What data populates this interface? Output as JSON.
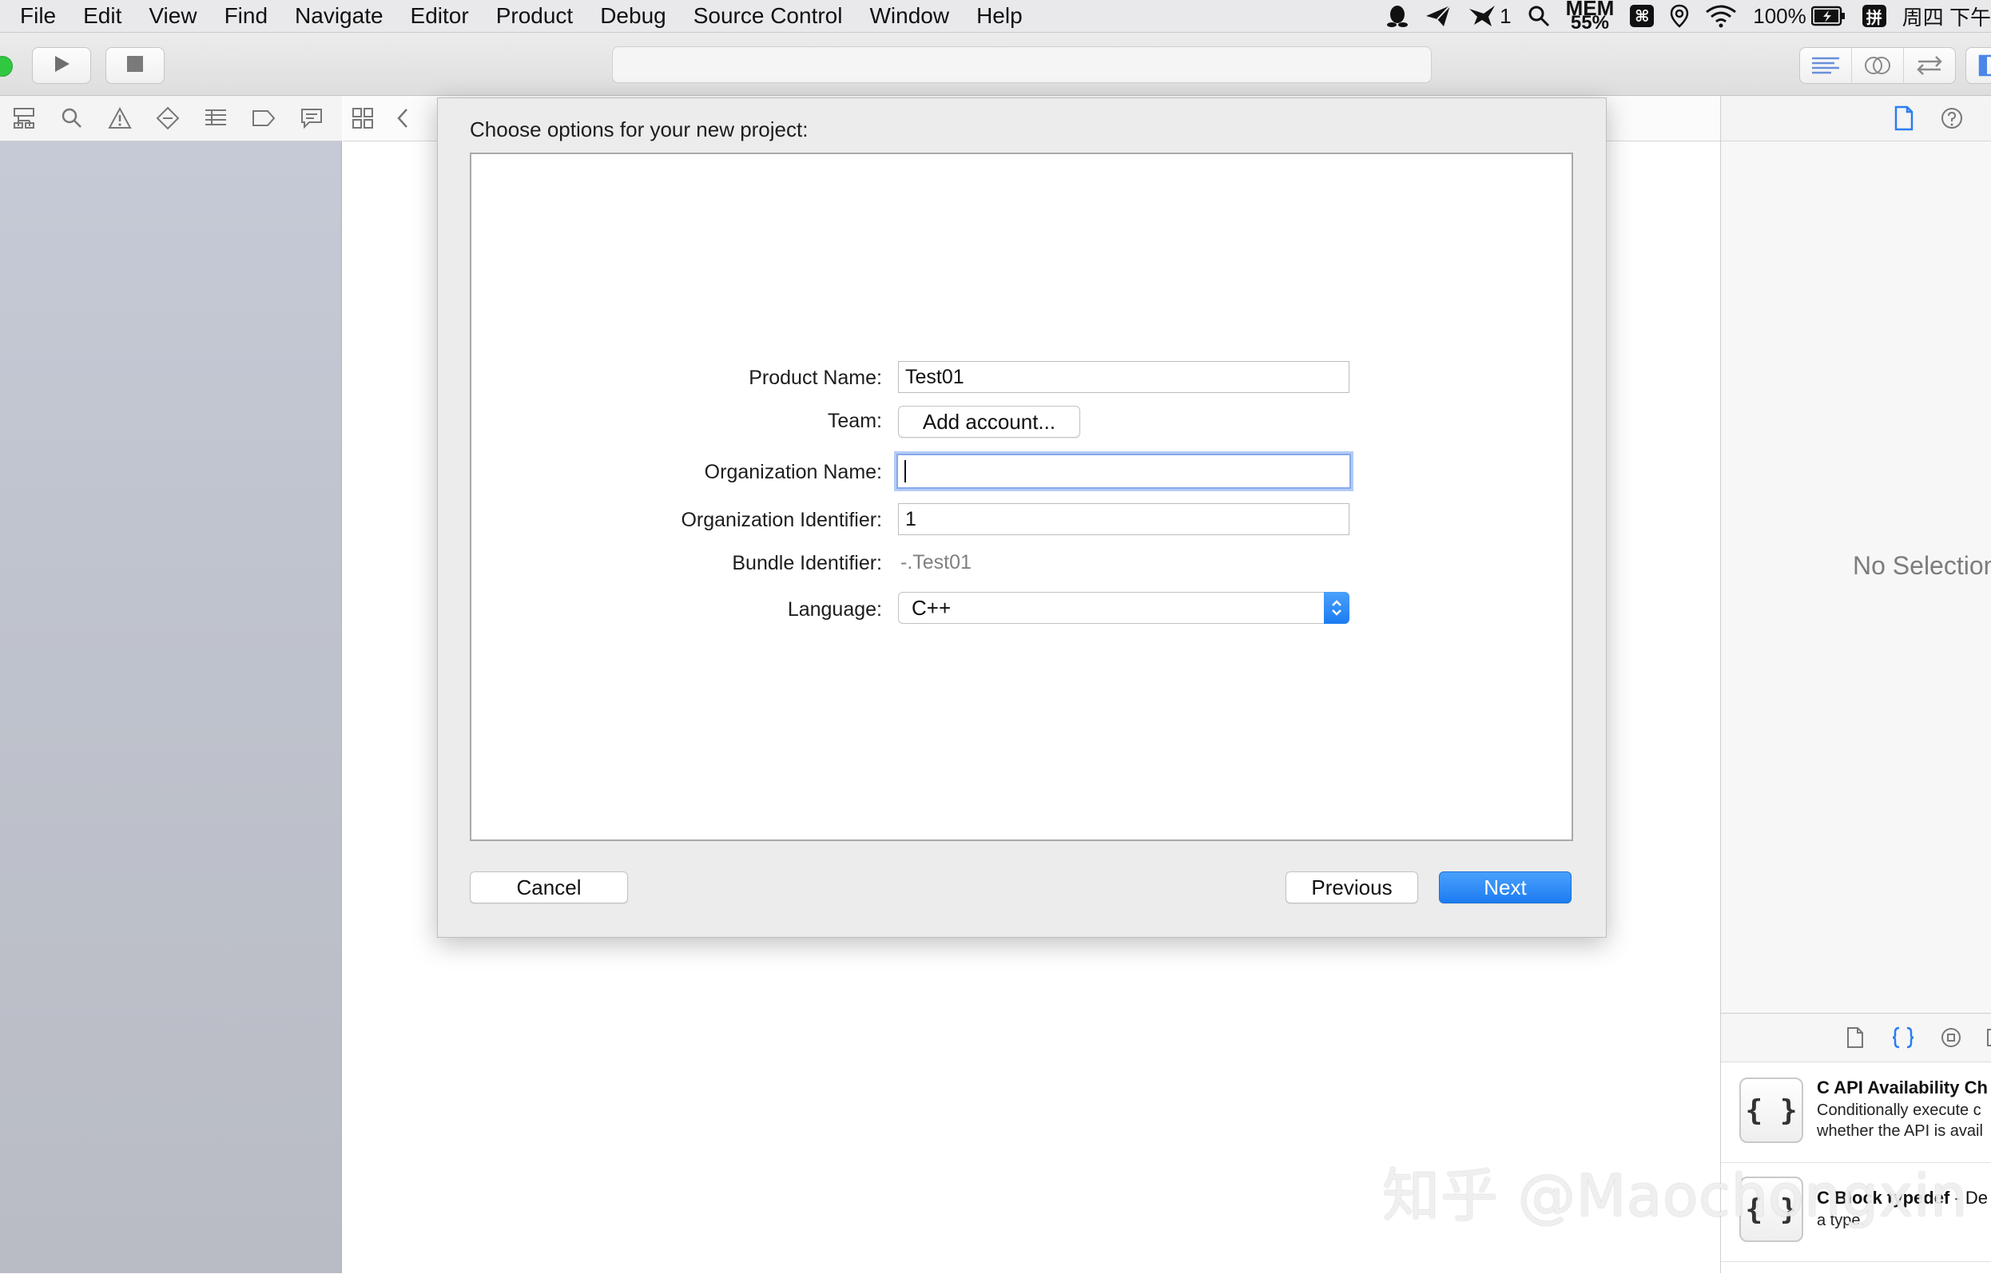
{
  "menubar": {
    "items": [
      "File",
      "Edit",
      "View",
      "Find",
      "Navigate",
      "Editor",
      "Product",
      "Debug",
      "Source Control",
      "Window",
      "Help"
    ],
    "status": {
      "notification_badge": "1",
      "mem_label": "MEM",
      "mem_value": "55%",
      "battery": "100%",
      "cmd_glyph": "⌘",
      "input_method": "拼",
      "clock": "周四 下午"
    }
  },
  "dialog": {
    "title": "Choose options for your new project:",
    "labels": {
      "product_name": "Product Name:",
      "team": "Team:",
      "org_name": "Organization Name:",
      "org_id": "Organization Identifier:",
      "bundle_id": "Bundle Identifier:",
      "language": "Language:"
    },
    "values": {
      "product_name": "Test01",
      "team_button": "Add account...",
      "org_name": "",
      "org_id": "1",
      "bundle_id": "-.Test01",
      "language": "C++"
    },
    "buttons": {
      "cancel": "Cancel",
      "previous": "Previous",
      "next": "Next"
    }
  },
  "inspector": {
    "empty_text": "No Selection",
    "library": [
      {
        "icon_text": "{ }",
        "title": "C API Availability Ch",
        "desc1": "Conditionally execute c",
        "desc2": "whether the API is avail"
      },
      {
        "icon_text": "{ }",
        "title": "C Block typedef",
        "title_suffix": " - De",
        "desc1": "a type."
      }
    ]
  },
  "watermark": "知乎 @Maochongxin",
  "colors": {
    "accent": "#1c7cf2",
    "focus_ring": "#85a9ea",
    "navigator_bg": "#c1c5cf"
  }
}
